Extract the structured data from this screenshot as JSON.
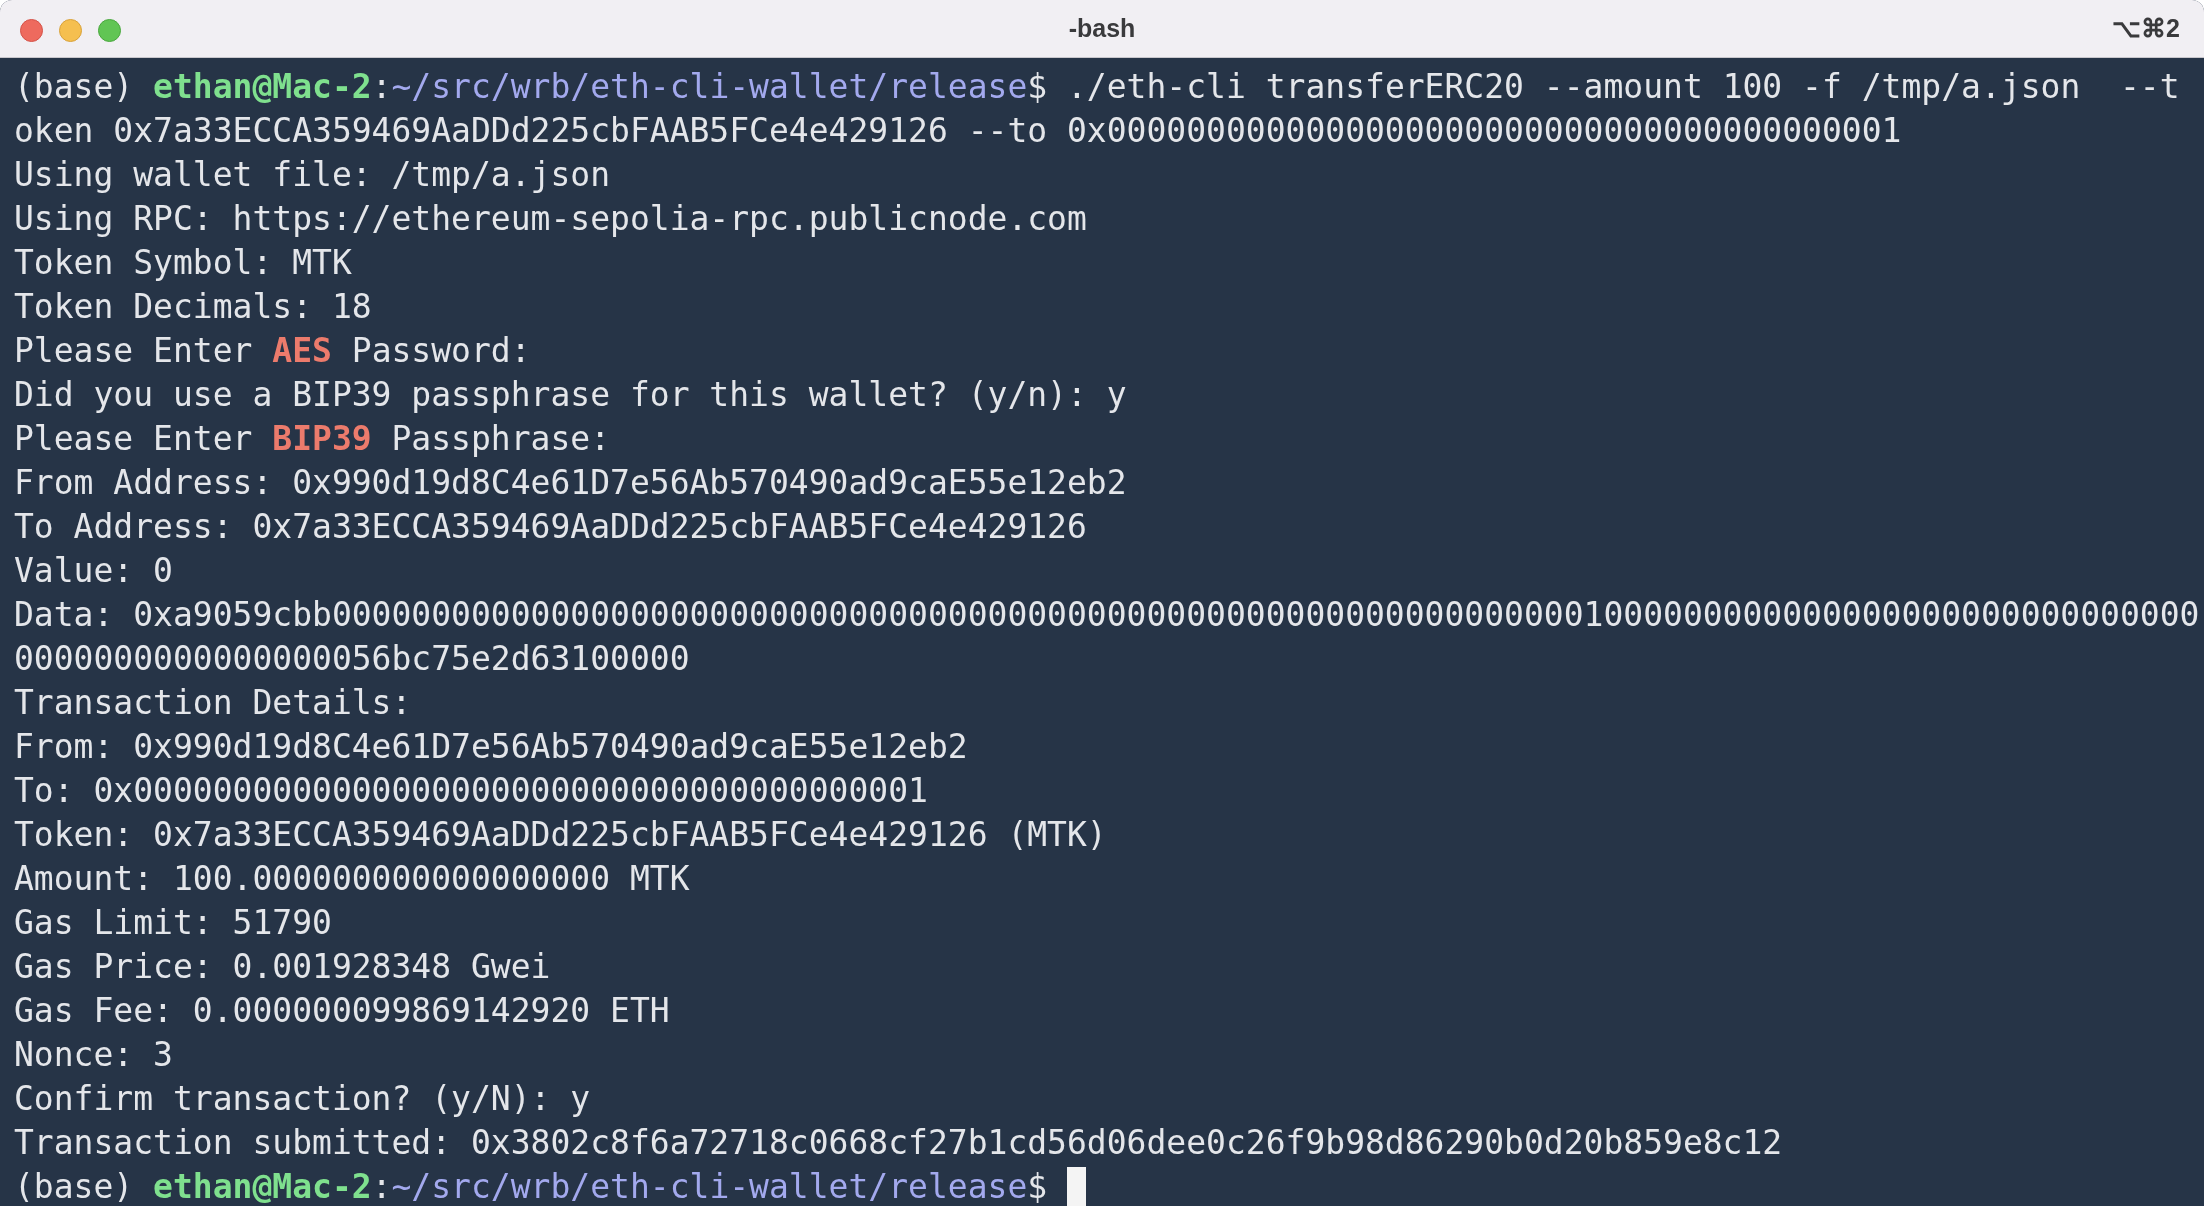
{
  "window": {
    "title": "-bash",
    "shortcut": "⌥⌘2"
  },
  "lines": [
    {
      "segments": [
        {
          "kind": "plain",
          "text": "(base) "
        },
        {
          "kind": "user",
          "text": "ethan@Mac-2"
        },
        {
          "kind": "plain",
          "text": ":"
        },
        {
          "kind": "path",
          "text": "~/src/wrb/eth-cli-wallet/release"
        },
        {
          "kind": "plain",
          "text": "$ ./eth-cli transferERC20 --amount 100 -f /tmp/a.json  --t"
        }
      ]
    },
    {
      "segments": [
        {
          "kind": "plain",
          "text": "oken 0x7a33ECCA359469AaDDd225cbFAAB5FCe4e429126 --to 0x0000000000000000000000000000000000000001"
        }
      ]
    },
    {
      "segments": [
        {
          "kind": "plain",
          "text": "Using wallet file: /tmp/a.json"
        }
      ]
    },
    {
      "segments": [
        {
          "kind": "plain",
          "text": "Using RPC: https://ethereum-sepolia-rpc.publicnode.com"
        }
      ]
    },
    {
      "segments": [
        {
          "kind": "plain",
          "text": "Token Symbol: MTK"
        }
      ]
    },
    {
      "segments": [
        {
          "kind": "plain",
          "text": "Token Decimals: 18"
        }
      ]
    },
    {
      "segments": [
        {
          "kind": "plain",
          "text": "Please Enter "
        },
        {
          "kind": "highlight",
          "text": "AES"
        },
        {
          "kind": "plain",
          "text": " Password:"
        }
      ]
    },
    {
      "segments": [
        {
          "kind": "plain",
          "text": "Did you use a BIP39 passphrase for this wallet? (y/n): y"
        }
      ]
    },
    {
      "segments": [
        {
          "kind": "plain",
          "text": "Please Enter "
        },
        {
          "kind": "highlight",
          "text": "BIP39"
        },
        {
          "kind": "plain",
          "text": " Passphrase:"
        }
      ]
    },
    {
      "segments": [
        {
          "kind": "plain",
          "text": "From Address: 0x990d19d8C4e61D7e56Ab570490ad9caE55e12eb2"
        }
      ]
    },
    {
      "segments": [
        {
          "kind": "plain",
          "text": "To Address: 0x7a33ECCA359469AaDDd225cbFAAB5FCe4e429126"
        }
      ]
    },
    {
      "segments": [
        {
          "kind": "plain",
          "text": "Value: 0"
        }
      ]
    },
    {
      "segments": [
        {
          "kind": "plain",
          "text": "Data: 0xa9059cbb0000000000000000000000000000000000000000000000000000000000000001000000000000000000000000000000"
        }
      ]
    },
    {
      "segments": [
        {
          "kind": "plain",
          "text": "0000000000000000056bc75e2d63100000"
        }
      ]
    },
    {
      "segments": [
        {
          "kind": "plain",
          "text": "Transaction Details:"
        }
      ]
    },
    {
      "segments": [
        {
          "kind": "plain",
          "text": "From: 0x990d19d8C4e61D7e56Ab570490ad9caE55e12eb2"
        }
      ]
    },
    {
      "segments": [
        {
          "kind": "plain",
          "text": "To: 0x0000000000000000000000000000000000000001"
        }
      ]
    },
    {
      "segments": [
        {
          "kind": "plain",
          "text": "Token: 0x7a33ECCA359469AaDDd225cbFAAB5FCe4e429126 (MTK)"
        }
      ]
    },
    {
      "segments": [
        {
          "kind": "plain",
          "text": "Amount: 100.000000000000000000 MTK"
        }
      ]
    },
    {
      "segments": [
        {
          "kind": "plain",
          "text": "Gas Limit: 51790"
        }
      ]
    },
    {
      "segments": [
        {
          "kind": "plain",
          "text": "Gas Price: 0.001928348 Gwei"
        }
      ]
    },
    {
      "segments": [
        {
          "kind": "plain",
          "text": "Gas Fee: 0.000000099869142920 ETH"
        }
      ]
    },
    {
      "segments": [
        {
          "kind": "plain",
          "text": "Nonce: 3"
        }
      ]
    },
    {
      "segments": [
        {
          "kind": "plain",
          "text": "Confirm transaction? (y/N): y"
        }
      ]
    },
    {
      "segments": [
        {
          "kind": "plain",
          "text": "Transaction submitted: 0x3802c8f6a72718c0668cf27b1cd56d06dee0c26f9b98d86290b0d20b859e8c12"
        }
      ]
    },
    {
      "segments": [
        {
          "kind": "plain",
          "text": "(base) "
        },
        {
          "kind": "user",
          "text": "ethan@Mac-2"
        },
        {
          "kind": "plain",
          "text": ":"
        },
        {
          "kind": "path",
          "text": "~/src/wrb/eth-cli-wallet/release"
        },
        {
          "kind": "plain",
          "text": "$ "
        }
      ],
      "cursor": true
    }
  ]
}
